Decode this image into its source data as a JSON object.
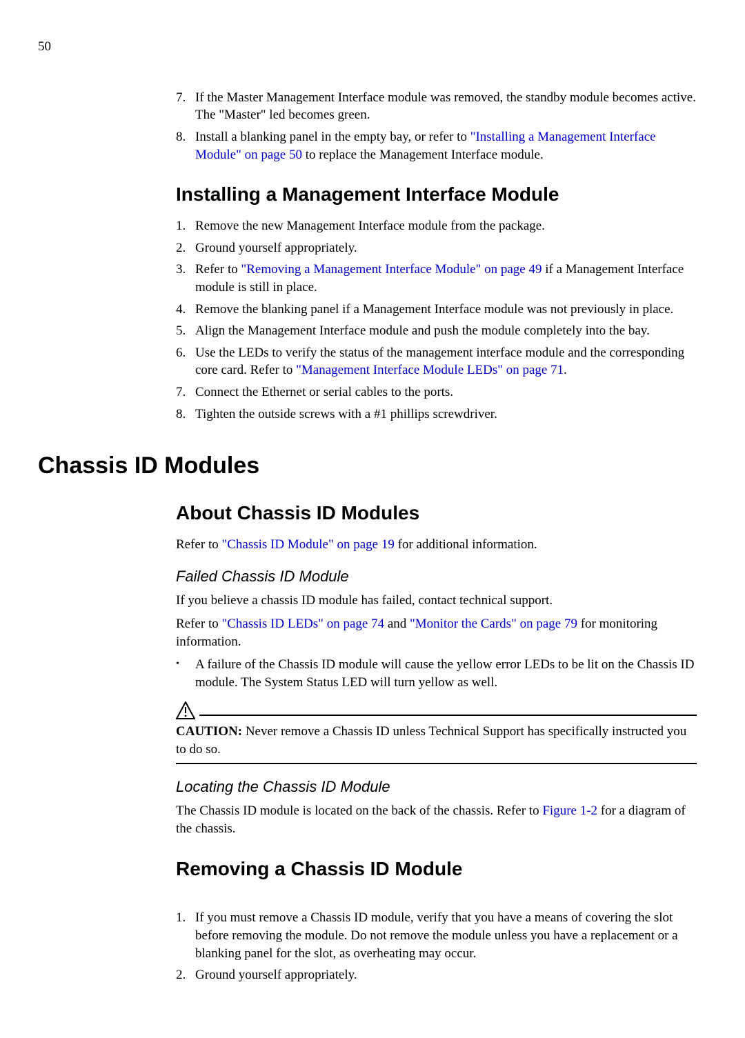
{
  "page_number": "50",
  "top_list": {
    "items": [
      {
        "marker": "7.",
        "text": "If the Master Management Interface module was removed, the standby module becomes active. The \"Master\" led becomes green."
      },
      {
        "marker": "8.",
        "prefix": "Install a blanking panel in the empty bay, or refer to ",
        "link": "\"Installing a Management Interface Module\" on page 50",
        "suffix": " to replace the Management Interface module."
      }
    ]
  },
  "install_heading": "Installing a Management Interface Module",
  "install_list": {
    "items": [
      {
        "marker": "1.",
        "text": "Remove the new Management Interface module from the package."
      },
      {
        "marker": "2.",
        "text": "Ground yourself appropriately."
      },
      {
        "marker": "3.",
        "prefix": "Refer to ",
        "link": "\"Removing a Management Interface Module\" on page 49",
        "suffix": " if a Management Interface module is still in place."
      },
      {
        "marker": "4.",
        "text": "Remove the blanking panel if a Management Interface module was not previously in place."
      },
      {
        "marker": "5.",
        "text": "Align the Management Interface module and push the module completely into the bay."
      },
      {
        "marker": "6.",
        "prefix": "Use the LEDs to verify the status of the management interface module and the corresponding core card. Refer to ",
        "link": "\"Management Interface Module LEDs\" on page 71",
        "suffix": "."
      },
      {
        "marker": "7.",
        "text": "Connect the Ethernet or serial cables to the ports."
      },
      {
        "marker": "8.",
        "text": "Tighten the outside screws with a #1 phillips screwdriver."
      }
    ]
  },
  "chassis_major": "Chassis ID Modules",
  "about_heading": "About Chassis ID Modules",
  "about_para": {
    "prefix": "Refer to ",
    "link": "\"Chassis ID Module\" on page 19",
    "suffix": " for additional information."
  },
  "failed_heading": "Failed Chassis ID Module",
  "failed_para1": "If you believe a chassis ID module has failed, contact technical support.",
  "failed_para2": {
    "prefix": "Refer to ",
    "link1": "\"Chassis ID LEDs\" on page 74",
    "mid": " and ",
    "link2": "\"Monitor the Cards\" on page 79",
    "suffix": " for monitoring information."
  },
  "failed_bullet": "A failure of the Chassis ID module will cause the yellow error LEDs to be lit on the Chassis ID module. The System Status LED will turn yellow as well.",
  "caution_label": "CAUTION:",
  "caution_text": "  Never remove a Chassis ID unless Technical Support has specifically instructed you to do so.",
  "locating_heading": "Locating the Chassis ID Module",
  "locating_para": {
    "prefix": "The Chassis ID module is located on the back of the chassis. Refer to ",
    "link": "Figure 1-2",
    "suffix": " for a diagram of the chassis."
  },
  "removing_heading": "Removing a Chassis ID Module",
  "removing_list": {
    "items": [
      {
        "marker": "1.",
        "text": "If you must remove a Chassis ID module, verify that you have a means of covering the slot before removing the module. Do not remove the module unless you have a replacement or a blanking panel for the slot, as overheating may occur."
      },
      {
        "marker": "2.",
        "text": "Ground yourself appropriately."
      }
    ]
  }
}
